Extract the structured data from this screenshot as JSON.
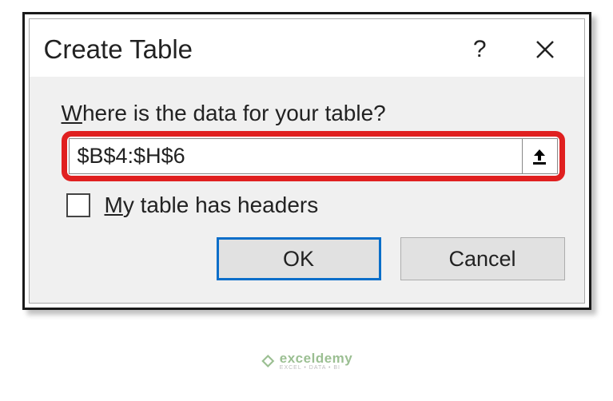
{
  "dialog": {
    "title": "Create Table",
    "prompt_prefix": "W",
    "prompt_rest": "here is the data for your table?",
    "range_value": "$B$4:$H$6",
    "checkbox_prefix": "M",
    "checkbox_rest": "y table has headers",
    "ok_label": "OK",
    "cancel_label": "Cancel"
  },
  "watermark": {
    "brand": "exceldemy",
    "tagline": "EXCEL • DATA • BI"
  }
}
